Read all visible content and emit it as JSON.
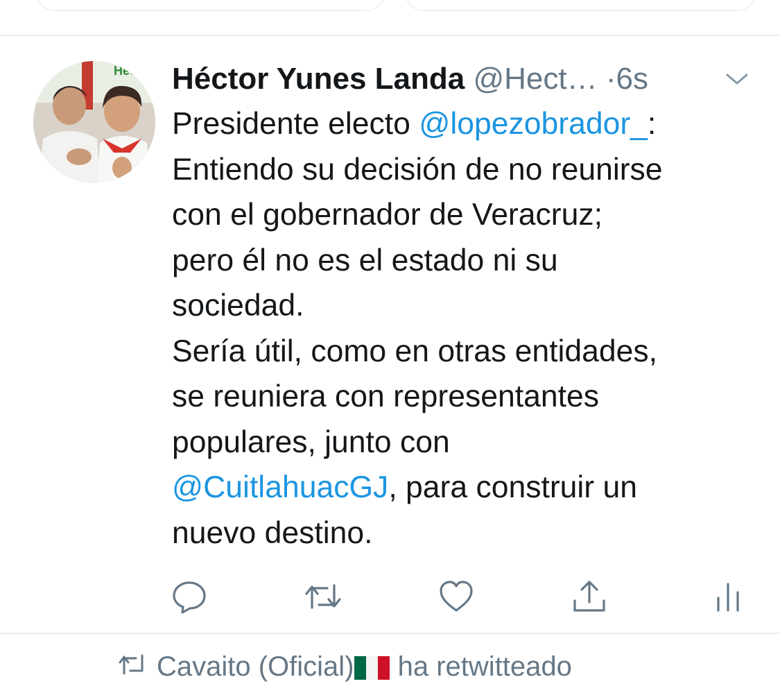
{
  "tweet": {
    "display_name": "Héctor Yunes Landa",
    "handle": "@Hect…",
    "separator": "·",
    "time": "6s",
    "avatar_text": "Hec",
    "text_intro": "Presidente electo ",
    "mention_1": "@lopezobrador_",
    "text_middle": ":\nEntiendo su decisión de no reunirse\ncon el gobernador de Veracruz;\npero él no es el estado ni su\nsociedad.\nSería útil, como en otras entidades,\nse reuniera con representantes\npopulares, junto con\n",
    "mention_2": "@CuitlahuacGJ",
    "text_end": ", para construir un\nnuevo destino."
  },
  "actions": [
    {
      "name": "reply",
      "icon": "reply-icon"
    },
    {
      "name": "retweet",
      "icon": "retweet-icon"
    },
    {
      "name": "like",
      "icon": "heart-icon"
    },
    {
      "name": "share",
      "icon": "share-icon"
    },
    {
      "name": "analytics",
      "icon": "analytics-icon"
    }
  ],
  "next_tweet": {
    "context_text": "Cavaito (Oficial)",
    "context_suffix": " ha retwitteado"
  },
  "colors": {
    "mention": "#1b95e0",
    "secondary": "#657786",
    "divider": "#e6ecf0",
    "avatar_logo": "#2e8b3a"
  }
}
